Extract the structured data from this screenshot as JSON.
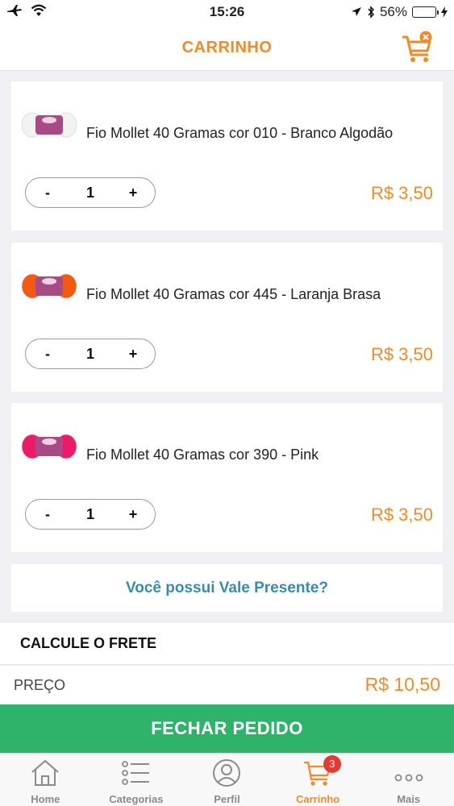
{
  "status_bar": {
    "time": "15:26",
    "battery": "56%",
    "battery_level": 0.56
  },
  "header": {
    "title": "CARRINHO",
    "accent_color": "#f08a2a"
  },
  "cart": {
    "items": [
      {
        "name": "Fio Mollet 40 Gramas cor 010 - Branco Algodão",
        "quantity": "1",
        "price": "R$ 3,50",
        "minus": "-",
        "plus": "+",
        "yarn_color": "#f2f2f2"
      },
      {
        "name": "Fio Mollet 40 Gramas cor 445 - Laranja Brasa",
        "quantity": "1",
        "price": "R$ 3,50",
        "minus": "-",
        "plus": "+",
        "yarn_color": "#f25a12"
      },
      {
        "name": "Fio Mollet 40 Gramas cor 390 - Pink",
        "quantity": "1",
        "price": "R$ 3,50",
        "minus": "-",
        "plus": "+",
        "yarn_color": "#ec1a68"
      }
    ]
  },
  "gift_card": {
    "label": "Você possui Vale Presente?"
  },
  "freight": {
    "label": "CALCULE O FRETE"
  },
  "summary": {
    "label": "PREÇO",
    "value": "R$ 10,50"
  },
  "checkout": {
    "label": "FECHAR PEDIDO",
    "color": "#2fb36a"
  },
  "tabs": [
    {
      "label": "Home",
      "icon": "home-icon"
    },
    {
      "label": "Categorias",
      "icon": "list-icon"
    },
    {
      "label": "Perfil",
      "icon": "user-icon"
    },
    {
      "label": "Carrinho",
      "icon": "cart-icon",
      "badge": "3",
      "active": true
    },
    {
      "label": "Mais",
      "icon": "more-icon"
    }
  ]
}
